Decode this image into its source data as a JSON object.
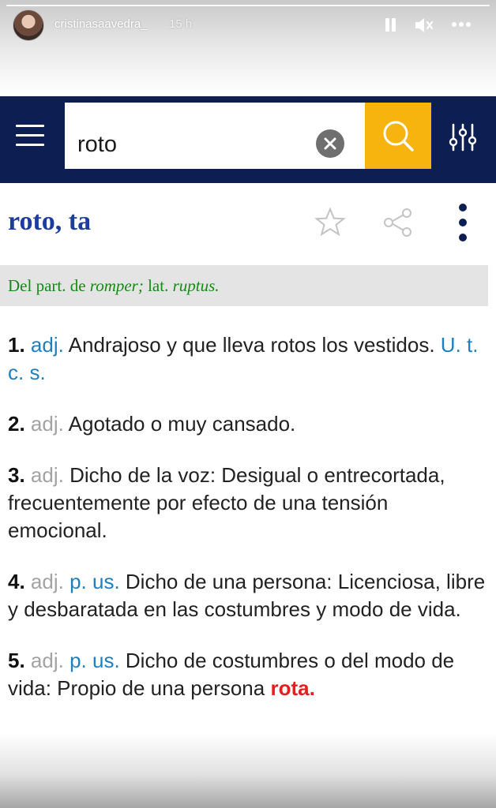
{
  "story": {
    "username": "cristinasaavedra_",
    "time_ago": "15 h",
    "icons": [
      "pause-icon",
      "mute-icon",
      "more-icon"
    ]
  },
  "search": {
    "query": "roto",
    "icons": [
      "menu-icon",
      "clear-icon",
      "search-icon",
      "filter-icon"
    ]
  },
  "colors": {
    "header_bg": "#0d1f52",
    "search_button": "#f7b40e",
    "headword": "#1d3d9e",
    "etymology": "#148a14",
    "abbrev_blue": "#1f7fbf",
    "abbrev_gray": "#a3a3a3",
    "highlight_red": "#e81e1e"
  },
  "entry": {
    "headword": "roto, ta",
    "actions": [
      "star-icon",
      "share-icon",
      "kebab-icon"
    ],
    "etymology": {
      "prefix": "Del part. de ",
      "word1": "romper;",
      "middle": " lat. ",
      "word2": "ruptus."
    },
    "definitions": [
      {
        "num": "1.",
        "pos": "adj.",
        "text": "Andrajoso y que lleva rotos los vestidos.",
        "note": "U. t. c. s."
      },
      {
        "num": "2.",
        "pos": "adj.",
        "text": "Agotado o muy cansado."
      },
      {
        "num": "3.",
        "pos": "adj.",
        "text": "Dicho de la voz: Desigual o entrecortada, frecuentemente por efecto de una tensión emocional."
      },
      {
        "num": "4.",
        "pos": "adj.",
        "usage": "p. us.",
        "text": "Dicho de una persona: Licenciosa, libre y desbaratada en las costumbres y modo de vida."
      },
      {
        "num": "5.",
        "pos": "adj.",
        "usage": "p. us.",
        "text": "Dicho de costumbres o del modo de vida: Propio de una persona",
        "highlight": "rota."
      }
    ]
  }
}
